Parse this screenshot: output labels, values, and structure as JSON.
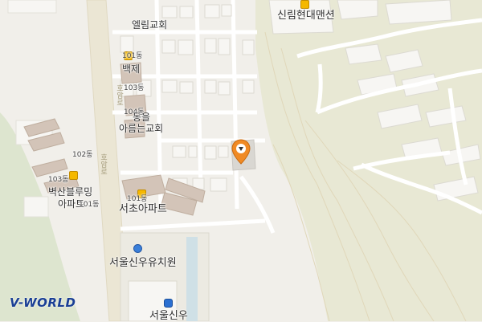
{
  "map": {
    "places": {
      "elim_church": "엘림교회",
      "sillim_mansion": "신림현대맨션",
      "baekxxx": "백제",
      "dong_101_a": "101동",
      "dong_103_a": "103동",
      "dong_104": "104동",
      "dong_101_b": "101동",
      "dong_102": "102동",
      "dong_103_b": "103동",
      "dong_101_c": "101동",
      "dong_eul": "동을",
      "seeing_church": "아름는교회",
      "byeoksan_apt_1": "벽산블루밍",
      "byeoksan_apt_2": "아파트",
      "seocho_apt": "서초아파트",
      "sinwoo_kindergarten": "서울신우유치원",
      "sinwoo_school": "서울신우"
    },
    "roads": {
      "hoamro_1": "호암로",
      "hoamro_2": "호암로"
    },
    "colors": {
      "background": "#f1efea",
      "forest": "#e8e8d5",
      "road": "#ffffff",
      "main_road": "#e9e4d2",
      "building": "#f7f6f3",
      "apartment": "#d1c2b6",
      "marker": "#f08a24"
    },
    "marker_icon": "map-pin-icon"
  },
  "logo": {
    "text_a": "V",
    "text_b": "-WORLD"
  }
}
